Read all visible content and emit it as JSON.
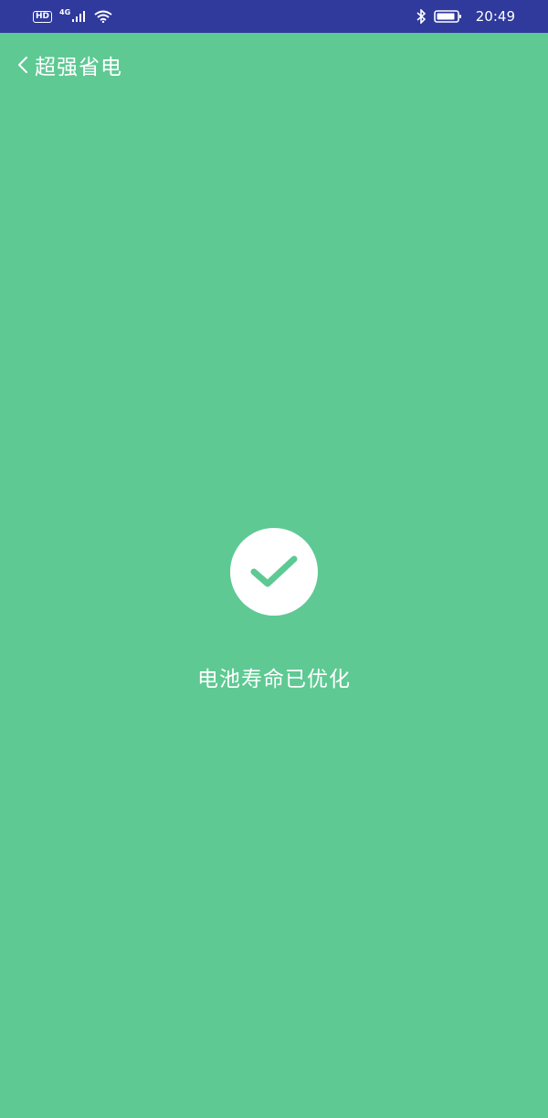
{
  "status_bar": {
    "hd_badge": "HD",
    "network_type": "4G",
    "time": "20:49",
    "icons": [
      "hd-icon",
      "signal-icon",
      "wifi-icon",
      "bluetooth-icon",
      "battery-icon"
    ]
  },
  "app_bar": {
    "back_icon": "chevron-left-icon",
    "title": "超强省电"
  },
  "result": {
    "icon": "check-icon",
    "message": "电池寿命已优化"
  },
  "colors": {
    "background": "#5ec993",
    "status_bar": "#2f3a9c",
    "check_circle": "#ffffff",
    "check_mark": "#5ec993"
  }
}
